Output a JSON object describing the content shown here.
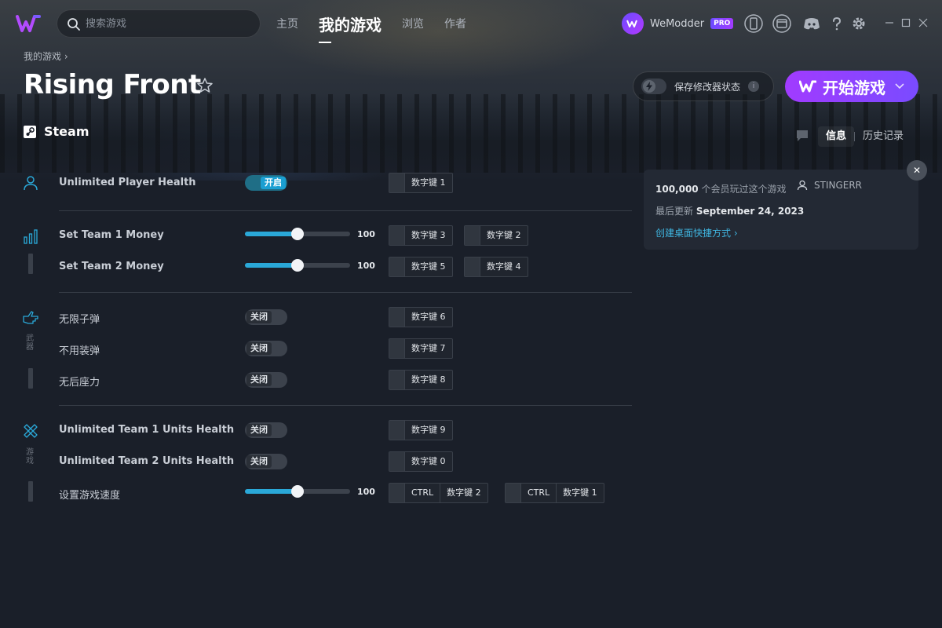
{
  "nav": {
    "search_placeholder": "搜索游戏",
    "items": [
      {
        "label": "主页",
        "active": false
      },
      {
        "label": "我的游戏",
        "active": true
      },
      {
        "label": "浏览",
        "active": false
      },
      {
        "label": "作者",
        "active": false
      }
    ]
  },
  "user": {
    "name": "WeModder",
    "badge": "PRO"
  },
  "header": {
    "breadcrumb": "我的游戏 ›",
    "title": "Rising Front",
    "platform": "Steam",
    "save_mods_label": "保存修改器状态",
    "save_mods_info": "i",
    "play_label": "开始游戏",
    "tabs": [
      {
        "label": "信息"
      },
      {
        "label": "历史记录"
      }
    ]
  },
  "groups": {
    "g3_label": "武器",
    "g4_label": "游戏"
  },
  "cheats": [
    {
      "label": "Unlimited Player Health",
      "type": "toggle",
      "state": "开启",
      "on": true,
      "keys": [
        [
          "数字键 1"
        ]
      ]
    },
    {
      "label": "Set Team 1 Money",
      "type": "slider",
      "value": "100",
      "fraction": 0.5,
      "keys": [
        [
          "数字键 3"
        ],
        [
          "数字键 2"
        ]
      ]
    },
    {
      "label": "Set Team 2 Money",
      "type": "slider",
      "value": "100",
      "fraction": 0.5,
      "keys": [
        [
          "数字键 5"
        ],
        [
          "数字键 4"
        ]
      ]
    },
    {
      "label": "无限子弹",
      "type": "toggle",
      "state": "关闭",
      "on": false,
      "keys": [
        [
          "数字键 6"
        ]
      ]
    },
    {
      "label": "不用装弹",
      "type": "toggle",
      "state": "关闭",
      "on": false,
      "keys": [
        [
          "数字键 7"
        ]
      ]
    },
    {
      "label": "无后座力",
      "type": "toggle",
      "state": "关闭",
      "on": false,
      "keys": [
        [
          "数字键 8"
        ]
      ]
    },
    {
      "label": "Unlimited Team 1 Units Health",
      "type": "toggle",
      "state": "关闭",
      "on": false,
      "keys": [
        [
          "数字键 9"
        ]
      ]
    },
    {
      "label": "Unlimited Team 2 Units Health",
      "type": "toggle",
      "state": "关闭",
      "on": false,
      "keys": [
        [
          "数字键 0"
        ]
      ]
    },
    {
      "label": "设置游戏速度",
      "type": "slider",
      "value": "100",
      "fraction": 0.5,
      "keys": [
        [
          "CTRL",
          "数字键 2"
        ],
        [
          "CTRL",
          "数字键 1"
        ]
      ]
    }
  ],
  "info": {
    "players_count": "100,000",
    "players_text": "个会员玩过这个游戏",
    "author": "STINGERR",
    "updated_prefix": "最后更新",
    "updated_date": "September 24, 2023",
    "shortcut_link": "创建桌面快捷方式 ›",
    "close_symbol": "✕"
  },
  "colors": {
    "accent": "#2aa8d8",
    "play": "#a13bff",
    "toggle_on": "#1a9fd2"
  }
}
